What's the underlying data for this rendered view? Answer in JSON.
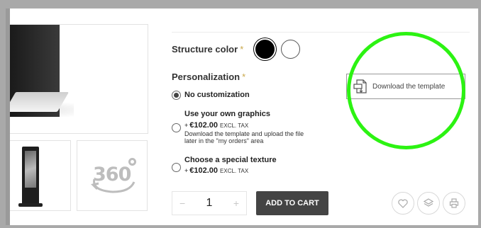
{
  "structure": {
    "label": "Structure color",
    "required_mark": "*",
    "colors": [
      "#000000",
      "#ffffff"
    ]
  },
  "personalization": {
    "label": "Personalization",
    "required_mark": "*",
    "options": [
      {
        "title": "No customization"
      },
      {
        "title": "Use your own graphics",
        "plus": "+",
        "price": "€102.00",
        "tax": "EXCL. TAX",
        "desc_line1": "Download the template and upload the file",
        "desc_line2": "later in the \"my orders\" area"
      },
      {
        "title": "Choose a special texture",
        "plus": "+",
        "price": "€102.00",
        "tax": "EXCL. TAX"
      }
    ]
  },
  "download": {
    "label": "Download the template"
  },
  "cart": {
    "minus": "−",
    "quantity": "1",
    "plus": "+",
    "add_label": "ADD TO CART"
  },
  "gallery": {
    "view360": "360"
  },
  "colors": {
    "accent_ring": "#2cf312",
    "button_dark": "#444444"
  }
}
